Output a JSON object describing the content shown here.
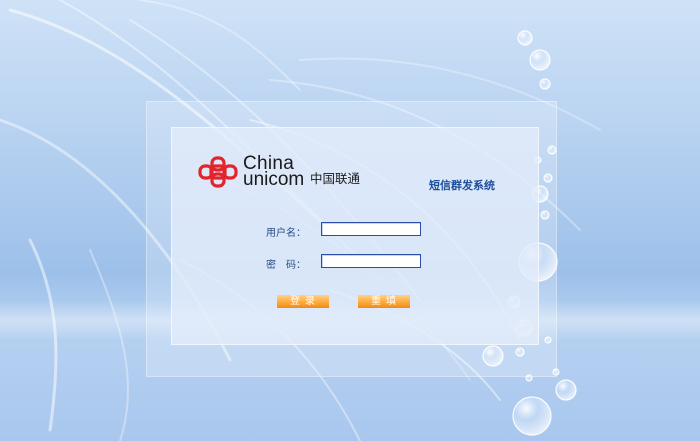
{
  "logo": {
    "en_line1": "China",
    "en_line2": "unicom",
    "cn_name": "中国联通"
  },
  "system_title": "短信群发系统",
  "form": {
    "username_label": "用户名：",
    "username_value": "",
    "password_label": "密　码：",
    "password_value": ""
  },
  "buttons": {
    "login_label": "登录",
    "reset_label": "重填"
  },
  "colors": {
    "accent_orange": "#f39a1e",
    "logo_red": "#e3242b",
    "title_blue": "#1e4f9c",
    "input_border": "#2d4ea8"
  }
}
